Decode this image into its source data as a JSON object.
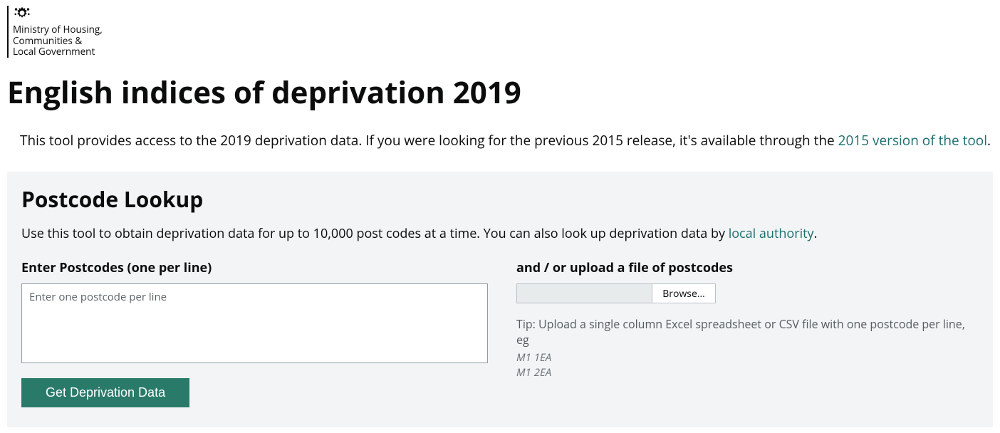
{
  "header": {
    "ministry_line_1": "Ministry of Housing,",
    "ministry_line_2": "Communities &",
    "ministry_line_3": "Local Government"
  },
  "page": {
    "title": "English indices of deprivation 2019",
    "intro_prefix": "This tool provides access to the 2019 deprivation data. If you were looking for the previous 2015 release, it's available through the ",
    "intro_link": "2015 version of the tool",
    "intro_suffix": "."
  },
  "lookup": {
    "title": "Postcode Lookup",
    "desc_prefix": "Use this tool to obtain deprivation data for up to 10,000 post codes at a time. You can also look up deprivation data by ",
    "desc_link": "local authority",
    "desc_suffix": ".",
    "postcode_label": "Enter Postcodes (one per line)",
    "postcode_placeholder": "Enter one postcode per line",
    "upload_label": "and / or upload a file of postcodes",
    "browse_button": "Browse…",
    "tip_text": "Tip: Upload a single column Excel spreadsheet or CSV file with one postcode per line, eg",
    "tip_example_1": "M1 1EA",
    "tip_example_2": "M1 2EA",
    "submit_button": "Get Deprivation Data"
  }
}
